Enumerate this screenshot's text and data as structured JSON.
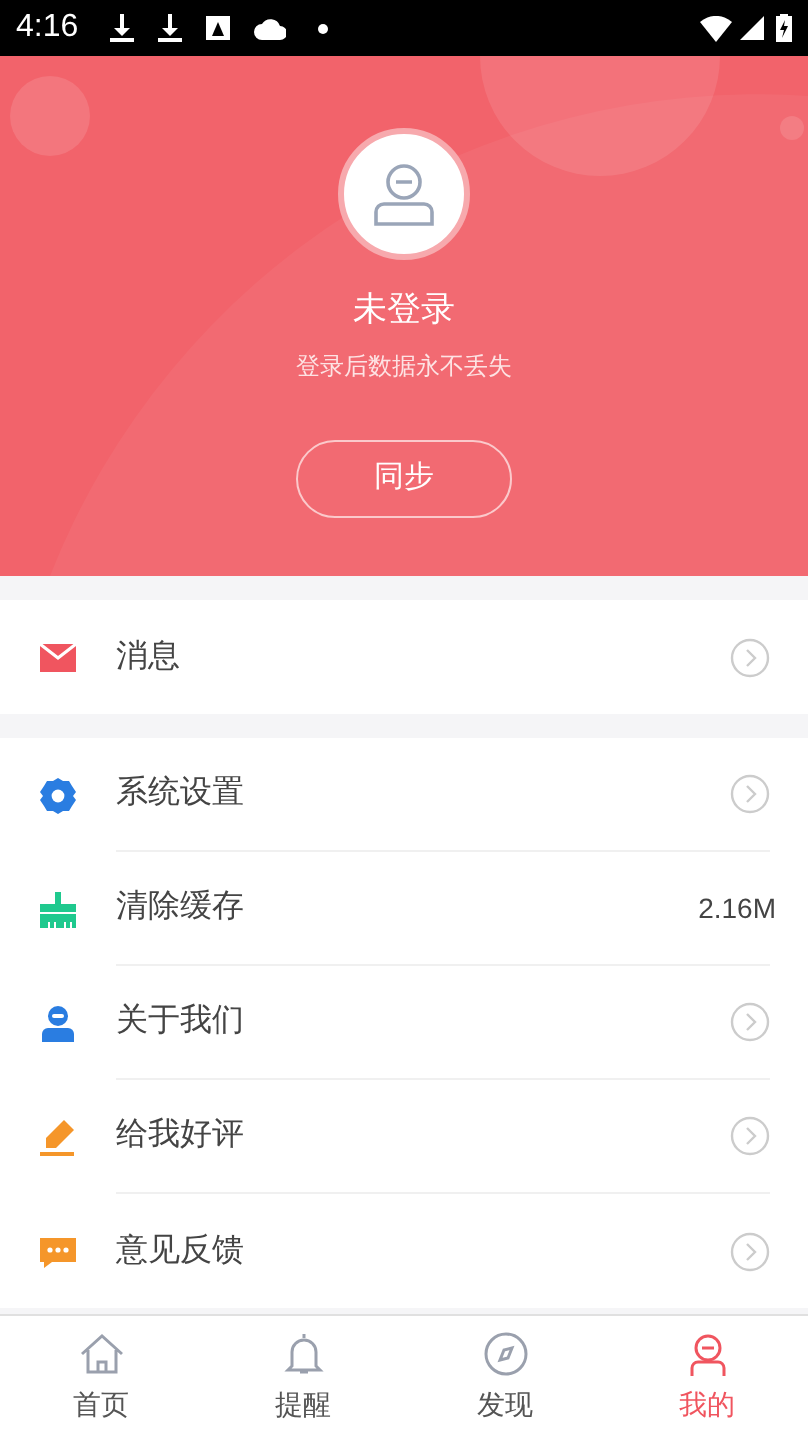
{
  "status_bar": {
    "time": "4:16"
  },
  "profile": {
    "name": "未登录",
    "subtitle": "登录后数据永不丢失",
    "button": "同步"
  },
  "sections": [
    [
      {
        "kind": "mail",
        "label": "消息"
      }
    ],
    [
      {
        "kind": "gear",
        "label": "系统设置"
      },
      {
        "kind": "brush",
        "label": "清除缓存",
        "value": "2.16M"
      },
      {
        "kind": "user",
        "label": "关于我们"
      },
      {
        "kind": "pencil",
        "label": "给我好评"
      },
      {
        "kind": "chat",
        "label": "意见反馈"
      }
    ]
  ],
  "tabs": [
    {
      "kind": "home",
      "label": "首页",
      "selected": false
    },
    {
      "kind": "bell",
      "label": "提醒",
      "selected": false
    },
    {
      "kind": "compass",
      "label": "发现",
      "selected": false
    },
    {
      "kind": "profile",
      "label": "我的",
      "selected": true
    }
  ]
}
